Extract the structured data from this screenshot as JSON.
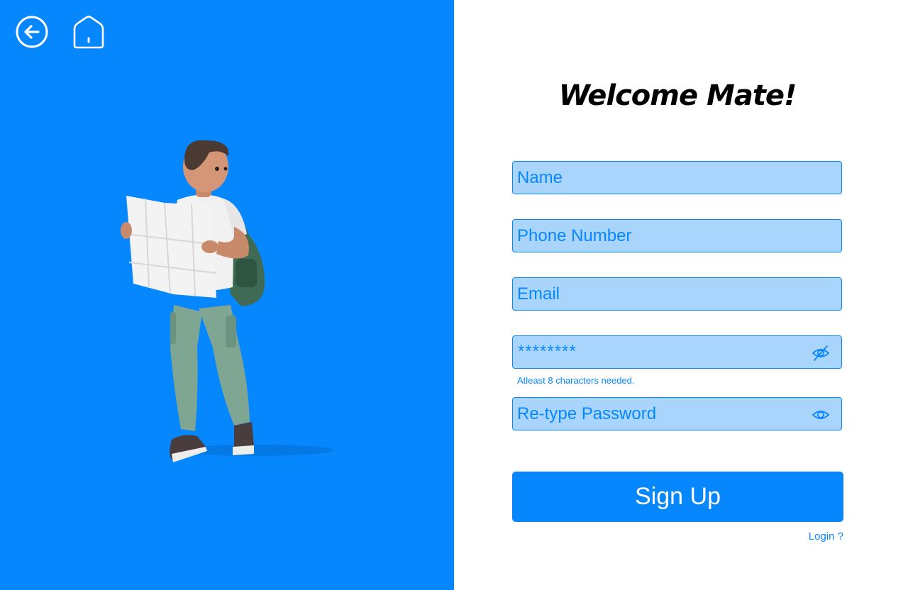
{
  "colors": {
    "accent": "#0787FE",
    "field_bg": "#A9D5FD",
    "panel_bg": "#0787FE"
  },
  "nav": {
    "back_icon": "arrow-left-circle-icon",
    "home_icon": "home-icon"
  },
  "form": {
    "title": "Welcome Mate!",
    "name_placeholder": "Name",
    "phone_placeholder": "Phone Number",
    "email_placeholder": "Email",
    "password_value": "********",
    "password_hint": "Atleast 8 characters needed.",
    "password_icon": "eye-off-icon",
    "retype_placeholder": "Re-type Password",
    "retype_icon": "eye-icon",
    "signup_label": "Sign Up",
    "login_link": "Login ?"
  }
}
